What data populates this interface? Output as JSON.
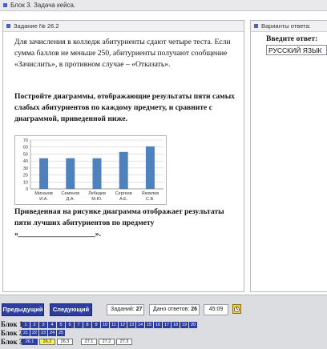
{
  "window": {
    "title": "Блок 3. Задача кейса."
  },
  "task": {
    "header": "Задание № 26.2",
    "p1": "Для зачисления в колледж абитуриенты сдают четыре теста. Если сумма баллов не меньше 250, абитуриенты получают сообщение «Зачислить», в противном случае – «Отказать».",
    "p2": "Постройте диаграммы, отображающие результаты пяти самых слабых абитуриентов по каждому предмету, и сравните с диаграммой, приведенной ниже.",
    "p3": "Приведенная на рисунке диаграмма отображает результаты пяти лучших абитуриентов по предмету «____________________»."
  },
  "chart_data": {
    "type": "bar",
    "categories": [
      "Миханов И.А.",
      "Семенов Д.А.",
      "Лебедев М.Ю.",
      "Сергеев А.Е.",
      "Яковлев С.В."
    ],
    "category_lines": [
      [
        "Миханов",
        "И.А."
      ],
      [
        "Семенов",
        "Д.А."
      ],
      [
        "Лебедев",
        "М.Ю."
      ],
      [
        "Сергеев",
        "А.Е."
      ],
      [
        "Яковлев",
        "С.В."
      ]
    ],
    "values": [
      44,
      44,
      44,
      53,
      61
    ],
    "ylim": [
      0,
      70
    ],
    "yticks": [
      "0",
      "10",
      "20",
      "30",
      "40",
      "50",
      "60",
      "70"
    ],
    "grid": true,
    "bar_color": "#4f81bd",
    "title": "",
    "xlabel": "",
    "ylabel": ""
  },
  "answers": {
    "header": "Варианты ответа:",
    "label": "Введите ответ:",
    "value": "РУССКИЙ ЯЗЫК"
  },
  "footer": {
    "prev_label": "Предыдущий",
    "next_label": "Следующий",
    "tasks_label": "Заданий:",
    "tasks_count": "27",
    "given_label": "Дано ответов:",
    "given_count": "26",
    "timer": "45:09",
    "clock_icon": "clock-icon",
    "blocks": [
      {
        "label": "Блок 1",
        "cells": [
          "1",
          "2",
          "3",
          "4",
          "5",
          "6",
          "7",
          "8",
          "9",
          "10",
          "11",
          "12",
          "13",
          "14",
          "15",
          "16",
          "17",
          "18",
          "19",
          "20"
        ]
      },
      {
        "label": "Блок 2",
        "cells": [
          "21",
          "22",
          "23",
          "24",
          "25"
        ]
      },
      {
        "label": "Блок 3",
        "cells": [
          "26.1",
          "26.2",
          "26.3",
          "27.1",
          "27.2",
          "27.3"
        ]
      }
    ],
    "accent": "#2c3f9f",
    "current_cell_color": "#f5f25a"
  }
}
